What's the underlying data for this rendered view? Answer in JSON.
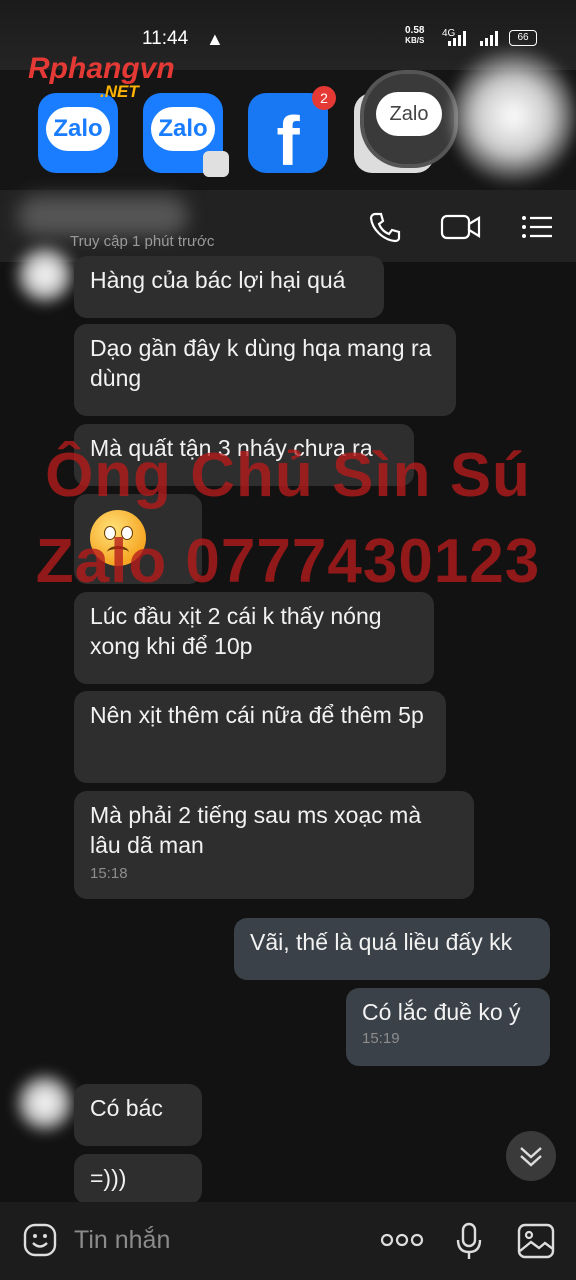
{
  "status_bar": {
    "time": "11:44",
    "net_speed": "0.58",
    "net_speed_unit": "KB/S",
    "network_type": "4G",
    "battery": "66"
  },
  "watermark": {
    "logo": "Rphangvn",
    "logo_suffix": ".NET",
    "overlay_line1": "Ông Chủ Sìn Sú",
    "overlay_line2": "Zalo 0777430123"
  },
  "recents": {
    "apps": [
      {
        "icon": "zalo-app-icon",
        "label": "Zalo"
      },
      {
        "icon": "zalo-app-icon",
        "label": "Zalo"
      },
      {
        "icon": "facebook-app-icon",
        "label": "f",
        "badge": "2"
      }
    ],
    "floating_bubble": "Zalo"
  },
  "header": {
    "subtitle": "Truy cập 1 phút trước",
    "icons": [
      "phone-icon",
      "video-call-icon",
      "menu-icon"
    ]
  },
  "messages": [
    {
      "dir": "in",
      "text": "Hàng của bác lợi hại quá"
    },
    {
      "dir": "in",
      "text": "Dạo gần đây k dùng hqa mang ra dùng"
    },
    {
      "dir": "in",
      "text": "Mà quất tận 3 nháy chưa ra"
    },
    {
      "dir": "in",
      "sticker": "worried-face-emoji"
    },
    {
      "dir": "in",
      "text": "Lúc đầu xịt 2 cái k thấy nóng xong khi để 10p"
    },
    {
      "dir": "in",
      "text": "Nên xịt thêm cái nữa để thêm 5p"
    },
    {
      "dir": "in",
      "text": "Mà phải 2 tiếng sau ms xoạc mà lâu dã man",
      "time": "15:18"
    },
    {
      "dir": "out",
      "text": "Vãi, thế là quá liều đấy kk"
    },
    {
      "dir": "out",
      "text": "Có lắc đuề ko ý",
      "time": "15:19"
    },
    {
      "dir": "in",
      "text": "Có bác"
    },
    {
      "dir": "in",
      "text": "=)))"
    }
  ],
  "composer": {
    "placeholder": "Tin nhắn",
    "icons": [
      "emoji-icon",
      "more-icon",
      "mic-icon",
      "image-icon"
    ]
  },
  "colors": {
    "background": "#121212",
    "bubble_in": "#2e2e2e",
    "bubble_out": "#3b4148",
    "watermark": "#b71c1c"
  }
}
